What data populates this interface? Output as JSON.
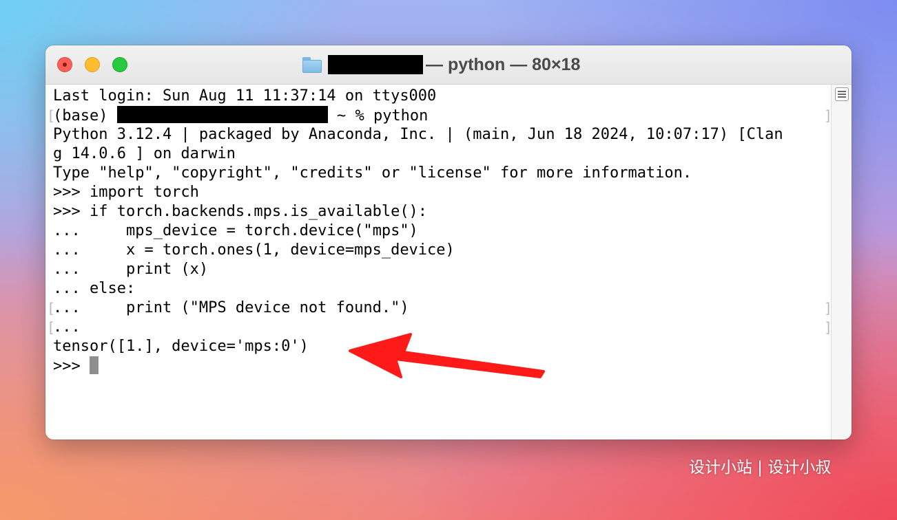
{
  "window": {
    "title_suffix": "— python — 80×18"
  },
  "terminal": {
    "lines": [
      "Last login: Sun Aug 11 11:37:14 on ttys000",
      "(base) ",
      "Python 3.12.4 | packaged by Anaconda, Inc. | (main, Jun 18 2024, 10:07:17) [Clan",
      "g 14.0.6 ] on darwin",
      "Type \"help\", \"copyright\", \"credits\" or \"license\" for more information.",
      ">>> import torch",
      ">>> if torch.backends.mps.is_available():",
      "...     mps_device = torch.device(\"mps\")",
      "...     x = torch.ones(1, device=mps_device)",
      "...     print (x)",
      "... else:",
      "...     print (\"MPS device not found.\")",
      "...",
      "tensor([1.], device='mps:0')",
      ">>> "
    ],
    "prompt_suffix": " ~ % python"
  },
  "watermark": {
    "text": "设计小站 | 设计小叔"
  },
  "colors": {
    "arrow": "#ff1a1a",
    "close": "#fe5f57",
    "minimize": "#febc2e",
    "maximize": "#28c840"
  },
  "icons": {
    "title": "folder-icon",
    "scroll": "scrollbar-toggle-icon"
  }
}
